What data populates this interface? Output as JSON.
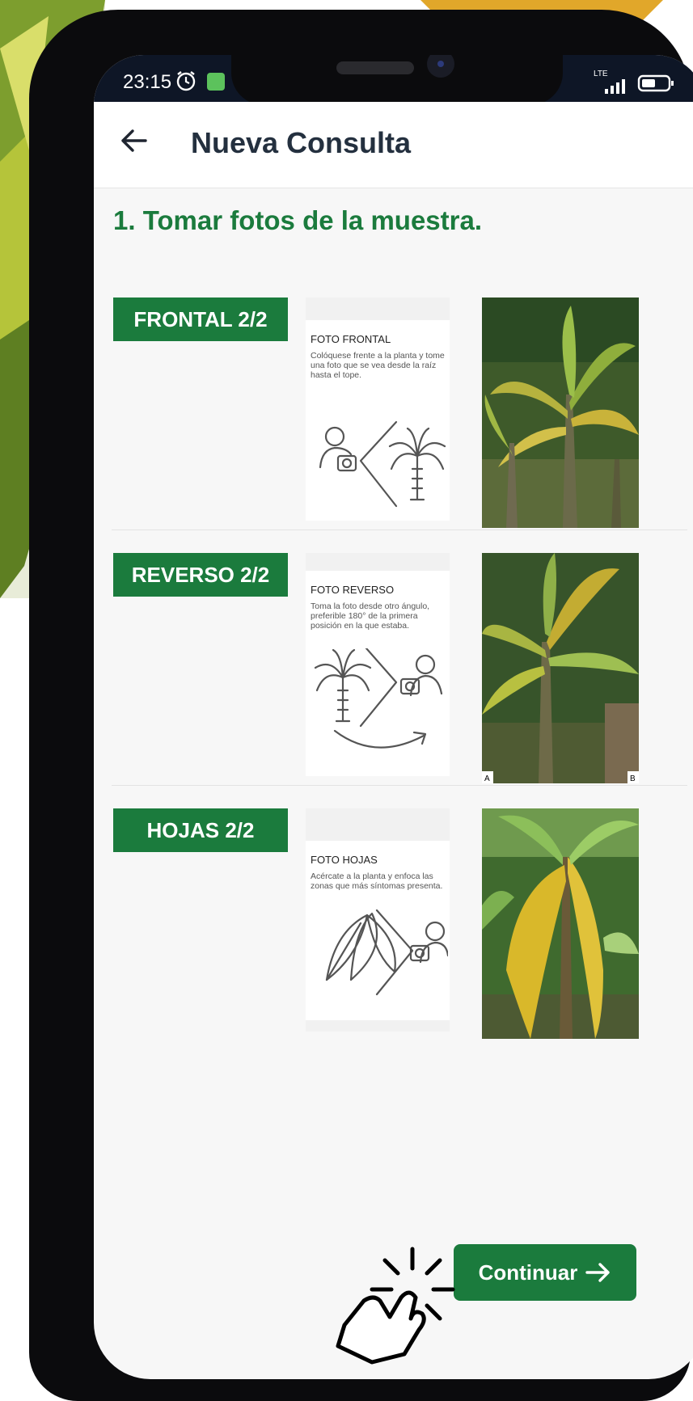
{
  "status_bar": {
    "time": "23:15",
    "network": "LTE"
  },
  "app_bar": {
    "title": "Nueva Consulta"
  },
  "section": {
    "title": "1. Tomar fotos de la muestra."
  },
  "steps": [
    {
      "badge": "FRONTAL 2/2",
      "guide_title": "FOTO FRONTAL",
      "guide_text": "Colóquese frente a la planta y tome una foto que se vea desde la raíz hasta el tope."
    },
    {
      "badge": "REVERSO 2/2",
      "guide_title": "FOTO REVERSO",
      "guide_text": "Toma la foto desde otro ángulo, preferible 180° de la primera posición en la que estaba.",
      "photo_labels": [
        "A",
        "B"
      ]
    },
    {
      "badge": "HOJAS 2/2",
      "guide_title": "FOTO HOJAS",
      "guide_text": "Acércate a la planta y enfoca las zonas que más síntomas presenta."
    }
  ],
  "actions": {
    "continue_label": "Continuar"
  },
  "colors": {
    "primary": "#1b7b3d",
    "title": "#24303f",
    "status_bar": "#0e1626"
  }
}
